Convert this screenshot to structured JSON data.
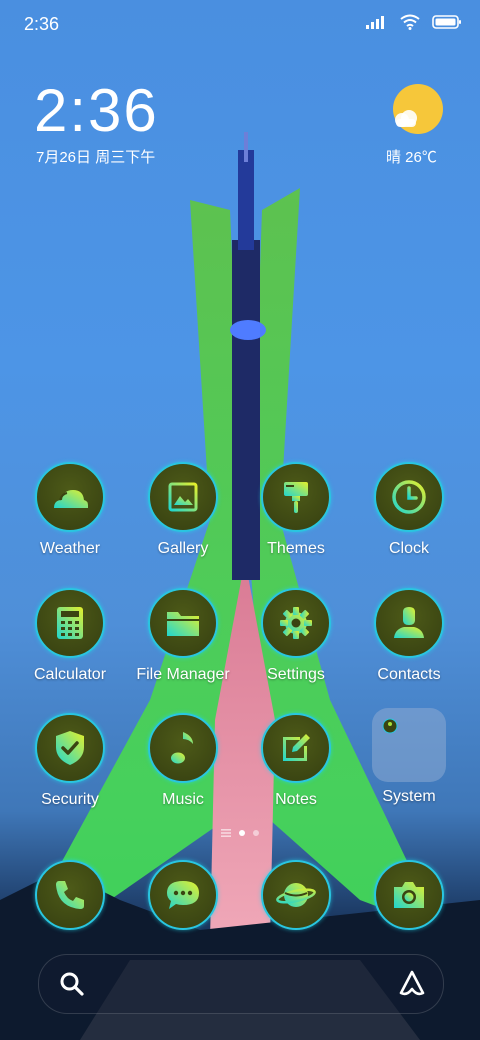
{
  "status_bar": {
    "time": "2:36",
    "icons": [
      "signal-icon",
      "wifi-icon",
      "battery-icon"
    ]
  },
  "clock_widget": {
    "time": "2:36",
    "date": "7月26日 周三下午"
  },
  "weather_widget": {
    "icon": "sun-cloud-icon",
    "text": "晴 26℃"
  },
  "apps": [
    {
      "label": "Weather",
      "icon": "weather-icon"
    },
    {
      "label": "Gallery",
      "icon": "gallery-icon"
    },
    {
      "label": "Themes",
      "icon": "themes-brush-icon"
    },
    {
      "label": "Clock",
      "icon": "clock-icon"
    },
    {
      "label": "Calculator",
      "icon": "calculator-icon"
    },
    {
      "label": "File Manager",
      "icon": "folder-icon"
    },
    {
      "label": "Settings",
      "icon": "gear-icon"
    },
    {
      "label": "Contacts",
      "icon": "contact-icon"
    },
    {
      "label": "Security",
      "icon": "shield-check-icon"
    },
    {
      "label": "Music",
      "icon": "music-note-icon"
    },
    {
      "label": "Notes",
      "icon": "notes-pencil-icon"
    },
    {
      "label": "System",
      "icon": "folder-group-icon"
    }
  ],
  "dock": [
    {
      "icon": "phone-icon"
    },
    {
      "icon": "message-icon"
    },
    {
      "icon": "planet-browser-icon"
    },
    {
      "icon": "camera-icon"
    }
  ],
  "page_indicator": {
    "pages": 2,
    "current": 1
  },
  "search_bar": {
    "left_icon": "search-icon",
    "right_icon": "assistant-icon"
  },
  "colors": {
    "icon_fill": "#3a4412",
    "icon_ring": "#29c6e0",
    "glyph_gradient_start": "#1fd6d0",
    "glyph_gradient_end": "#e6f02a"
  }
}
